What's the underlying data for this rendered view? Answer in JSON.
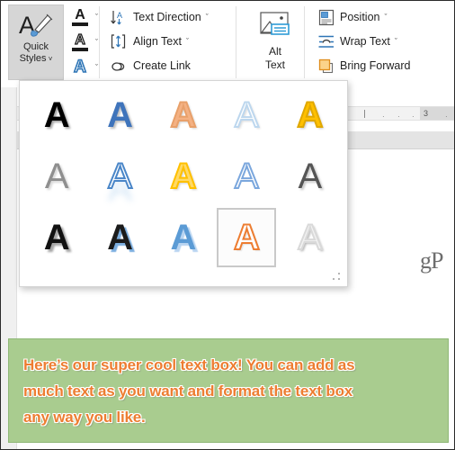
{
  "ribbon": {
    "quick_styles": {
      "label_line1": "Quick",
      "label_line2": "Styles",
      "chevron": "ˇ",
      "icon": "letter-a-with-brush-icon",
      "state": "active"
    },
    "a_stack": [
      {
        "glyph": "A",
        "icon": "text-fill-color-icon",
        "chevron": "ˇ",
        "color": "#1a1a1a",
        "bar_color": "#1a1a1a"
      },
      {
        "glyph": "A",
        "icon": "text-outline-color-icon",
        "chevron": "ˇ",
        "color": "#1a1a1a",
        "bar_color": "#1a1a1a"
      },
      {
        "glyph": "A",
        "icon": "text-effects-icon",
        "chevron": "ˇ",
        "color": "#2e75b6",
        "bar_color": ""
      }
    ],
    "text_group": [
      {
        "label": "Text Direction",
        "icon": "text-direction-icon",
        "chevron": "ˇ"
      },
      {
        "label": "Align Text",
        "icon": "align-text-icon",
        "chevron": "ˇ"
      },
      {
        "label": "Create Link",
        "icon": "create-link-icon",
        "chevron": ""
      }
    ],
    "alt_text": {
      "label_line1": "Alt",
      "label_line2": "Text",
      "icon": "alt-text-picture-icon"
    },
    "arrange_group": [
      {
        "label": "Position",
        "icon": "position-icon",
        "chevron": "ˇ"
      },
      {
        "label": "Wrap Text",
        "icon": "wrap-text-icon",
        "chevron": "ˇ"
      },
      {
        "label": "Bring Forward",
        "icon": "bring-forward-icon",
        "chevron": ""
      }
    ]
  },
  "gallery": {
    "name": "quick-styles-gallery",
    "columns": 5,
    "rows": 3,
    "resize_grip": "resize-grip-icon",
    "items": [
      {
        "id": "style-1",
        "letter": "A",
        "weight": "700",
        "fill": "#000000",
        "outline": "",
        "shadow": "2px 2px 2px rgba(150,150,150,0.85)",
        "selected": false
      },
      {
        "id": "style-2",
        "letter": "A",
        "weight": "700",
        "fill": "#3f74bb",
        "outline": "",
        "shadow": "2px 2px 2px rgba(175,175,175,0.8)",
        "selected": false
      },
      {
        "id": "style-3",
        "letter": "A",
        "weight": "700",
        "fill": "#f4b183",
        "outline": "#e8a06a",
        "shadow": "2px 2px 2px rgba(190,190,190,0.7)",
        "selected": false
      },
      {
        "id": "style-4",
        "letter": "A",
        "weight": "400",
        "fill": "#ffffff",
        "outline": "#bdd7ee",
        "shadow": "2px 2px 2px rgba(200,200,200,0.65)",
        "selected": false
      },
      {
        "id": "style-5",
        "letter": "A",
        "weight": "700",
        "fill": "#ffc000",
        "outline": "#e0a800",
        "shadow": "2px 2px 2px rgba(180,180,180,0.7)",
        "selected": false
      },
      {
        "id": "style-6",
        "letter": "A",
        "weight": "400",
        "fill": "#8f8f8f",
        "outline": "",
        "shadow": "2px 2px 2px rgba(200,200,200,0.7)",
        "selected": false
      },
      {
        "id": "style-7",
        "letter": "A",
        "weight": "400",
        "fill": "#ffffff",
        "outline": "#4a86c8",
        "shadow": "0 14px 7px rgba(160,200,235,0.45)",
        "selected": false
      },
      {
        "id": "style-8",
        "letter": "A",
        "weight": "700",
        "fill": "#ffd966",
        "outline": "#ffc000",
        "shadow": "2px 2px 2px rgba(190,190,190,0.7)",
        "selected": false
      },
      {
        "id": "style-9",
        "letter": "A",
        "weight": "400",
        "fill": "#ffffff",
        "outline": "#7ba7dd",
        "shadow": "",
        "selected": false
      },
      {
        "id": "style-10",
        "letter": "A",
        "weight": "400",
        "fill": "#555555",
        "outline": "",
        "shadow": "2px 2px 2px rgba(190,190,190,0.8)",
        "selected": false
      },
      {
        "id": "style-11",
        "letter": "A",
        "weight": "700",
        "fill": "#111111",
        "outline": "",
        "shadow": "3px 3px 2px rgba(160,160,160,0.95)",
        "selected": false
      },
      {
        "id": "style-12",
        "letter": "A",
        "weight": "700",
        "fill": "#1b1b1b",
        "outline": "",
        "shadow": "3px 3px 1px rgba(110,165,220,0.9)",
        "selected": false
      },
      {
        "id": "style-13",
        "letter": "A",
        "weight": "700",
        "fill": "#5b9bd5",
        "outline": "",
        "shadow": "3px 3px 1px rgba(180,210,240,0.95)",
        "selected": false
      },
      {
        "id": "style-14",
        "letter": "A",
        "weight": "700",
        "fill": "#ffffff",
        "outline": "#ed7d31",
        "shadow": "2px 2px 1px rgba(225,225,225,0.9)",
        "selected": true
      },
      {
        "id": "style-15",
        "letter": "A",
        "weight": "400",
        "fill": "#f2f2f2",
        "outline": "#d9d9d9",
        "shadow": "2px 2px 2px rgba(170,170,170,0.85)",
        "selected": false
      }
    ]
  },
  "document": {
    "ruler": {
      "name": "horizontal-ruler",
      "number": "3",
      "ticks": [
        "|",
        "·",
        "·",
        "·",
        "·"
      ],
      "indent_marker": "indent-marker-icon"
    },
    "watermark": "gP"
  },
  "textbox": {
    "name": "green-text-box",
    "fill_color": "#a9cc8f",
    "text_color": "#ed7d31",
    "lines": [
      "Here’s our super cool text box! You can add as",
      "much text as you want and format the text box",
      "any way you like."
    ]
  }
}
